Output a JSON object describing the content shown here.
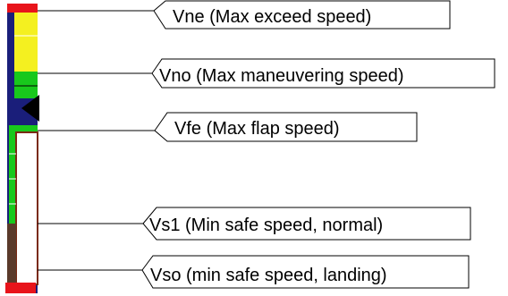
{
  "colors": {
    "red_band": "#e8141b",
    "yellow_band": "#f4f020",
    "green_band": "#18c81c",
    "navy": "#1a1e7a",
    "white_arc_border": "#7a2a14",
    "pointer": "#000000"
  },
  "pointer_icon": "black-triangle-pointer",
  "callouts": [
    {
      "id": "vne",
      "label": "Vne (Max exceed speed)"
    },
    {
      "id": "vno",
      "label": "Vno (Max maneuvering speed)"
    },
    {
      "id": "vfe",
      "label": "Vfe (Max flap speed)"
    },
    {
      "id": "vs1",
      "label": "Vs1 (Min safe speed, normal)"
    },
    {
      "id": "vso",
      "label": "Vso (min safe speed, landing)"
    }
  ]
}
